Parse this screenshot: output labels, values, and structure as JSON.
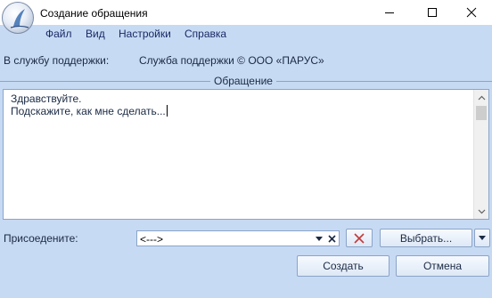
{
  "window": {
    "title": "Создание обращения",
    "controls": [
      "minimize-icon",
      "maximize-icon",
      "close-icon"
    ]
  },
  "menu": {
    "items": [
      "Файл",
      "Вид",
      "Настройки",
      "Справка"
    ]
  },
  "support": {
    "label": "В службу поддержки:",
    "value": "Служба поддержки © ООО «ПАРУС»"
  },
  "message": {
    "legend": "Обращение",
    "line1": "Здравствуйте.",
    "line2": "Подскажите, как мне сделать..."
  },
  "attach": {
    "label": "Присоедените:",
    "value": "<--->",
    "choose_label": "Выбрать..."
  },
  "actions": {
    "create_label": "Создать",
    "cancel_label": "Отмена"
  },
  "colors": {
    "window_bg": "#c7daf3",
    "border": "#8aa4c8",
    "delete_icon": "#c43a3a"
  }
}
